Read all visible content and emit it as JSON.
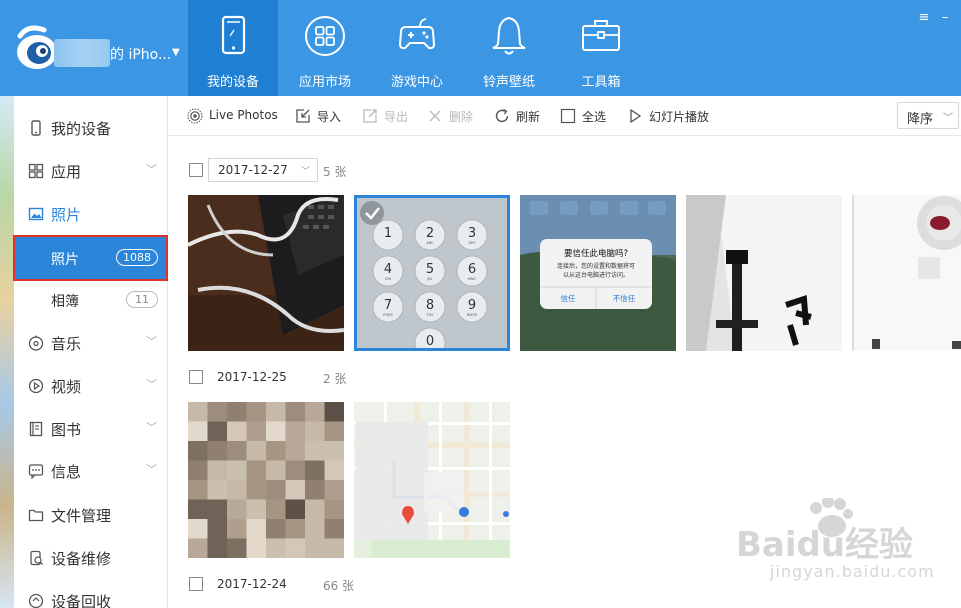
{
  "device": {
    "name_suffix": "的 iPho..."
  },
  "nav_tabs": [
    {
      "label": "我的设备",
      "icon": "tablet-icon"
    },
    {
      "label": "应用市场",
      "icon": "grid-icon"
    },
    {
      "label": "游戏中心",
      "icon": "gamepad-icon"
    },
    {
      "label": "铃声壁纸",
      "icon": "bell-icon"
    },
    {
      "label": "工具箱",
      "icon": "toolbox-icon"
    }
  ],
  "sidebar": {
    "items": [
      {
        "label": "我的设备",
        "icon": "phone-icon"
      },
      {
        "label": "应用",
        "icon": "apps-icon"
      },
      {
        "label": "照片",
        "icon": "photo-icon"
      },
      {
        "label": "音乐",
        "icon": "music-icon"
      },
      {
        "label": "视频",
        "icon": "video-icon"
      },
      {
        "label": "图书",
        "icon": "book-icon"
      },
      {
        "label": "信息",
        "icon": "message-icon"
      },
      {
        "label": "文件管理",
        "icon": "folder-icon"
      },
      {
        "label": "设备维修",
        "icon": "repair-icon"
      },
      {
        "label": "设备回收",
        "icon": "recycle-icon"
      }
    ],
    "subitems": [
      {
        "label": "照片",
        "count": "1088"
      },
      {
        "label": "相簿",
        "count": "11"
      }
    ]
  },
  "toolbar": {
    "live_photos": "Live Photos",
    "import": "导入",
    "export": "导出",
    "delete": "删除",
    "refresh": "刷新",
    "select_all": "全选",
    "slideshow": "幻灯片播放",
    "sort_value": "降序"
  },
  "groups": [
    {
      "date": "2017-12-27",
      "count": "5 张"
    },
    {
      "date": "2017-12-25",
      "count": "2 张"
    },
    {
      "date": "2017-12-24",
      "count": "66 张"
    }
  ],
  "photo_texts": {
    "trust_title": "要信任此电脑吗?",
    "trust_body_1": "连接后，您的设置和数据将可",
    "trust_body_2": "以从这台电脑进行访问。",
    "trust_yes": "信任",
    "trust_no": "不信任",
    "keypad_digits": [
      "1",
      "2",
      "3",
      "4",
      "5",
      "6",
      "7",
      "8",
      "9",
      "0"
    ],
    "keypad_letters": [
      "",
      "ABC",
      "DEF",
      "GHI",
      "JKL",
      "MNO",
      "PQRS",
      "TUV",
      "WXYZ",
      ""
    ]
  },
  "watermark": {
    "brand": "Baidu经验",
    "url": "jingyan.baidu.com"
  },
  "colors": {
    "topbar": "#3b97e3",
    "active_tab": "#1f7fd3",
    "accent": "#2b86d9",
    "highlight_border": "#e0302a"
  }
}
